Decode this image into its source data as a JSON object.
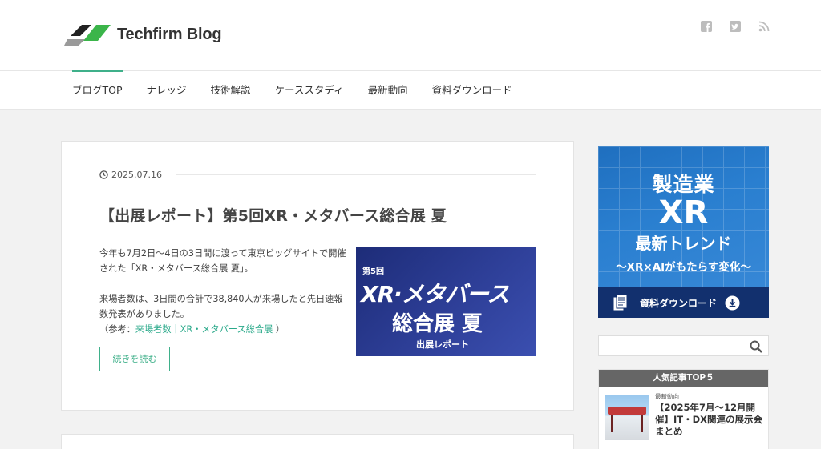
{
  "header": {
    "site_title": "Techfirm Blog",
    "social": [
      "facebook-icon",
      "twitter-icon",
      "rss-icon"
    ]
  },
  "nav": {
    "items": [
      {
        "label": "ブログTOP"
      },
      {
        "label": "ナレッジ"
      },
      {
        "label": "技術解説"
      },
      {
        "label": "ケーススタディ"
      },
      {
        "label": "最新動向"
      },
      {
        "label": "資料ダウンロード"
      }
    ],
    "active_index": 0
  },
  "post": {
    "date": "2025.07.16",
    "title": "【出展レポート】第5回XR・メタバース総合展 夏",
    "p1": "今年も7月2日〜4日の3日間に渡って東京ビッグサイトで開催された「XR・メタバース総合展 夏」。",
    "p2": "来場者数は、3日間の合計で38,840人が来場したと先日速報数発表がありました。",
    "ref_prefix": "（参考：",
    "ref_link": "来場者数｜XR・メタバース総合展",
    "ref_suffix": " ）",
    "more_label": "続きを読む",
    "thumb": {
      "line1": "第5回",
      "line2": "XR·メタバース",
      "line3": "総合展 夏",
      "line4": "出展レポート"
    }
  },
  "sidebar": {
    "banner": {
      "line1": "製造業",
      "line2": "XR",
      "line3": "最新トレンド",
      "line4": "〜XR×AIがもたらす変化〜",
      "download": "資料ダウンロード"
    },
    "search": {
      "placeholder": ""
    },
    "popular": {
      "heading": "人気記事TOP５",
      "items": [
        {
          "category": "最新動向",
          "title": "【2025年7月〜12月開催】IT・DX関連の展示会まとめ"
        }
      ]
    }
  },
  "colors": {
    "accent": "#3fb08a",
    "banner_blue": "#2a7fd0",
    "banner_dark": "#12306e"
  }
}
